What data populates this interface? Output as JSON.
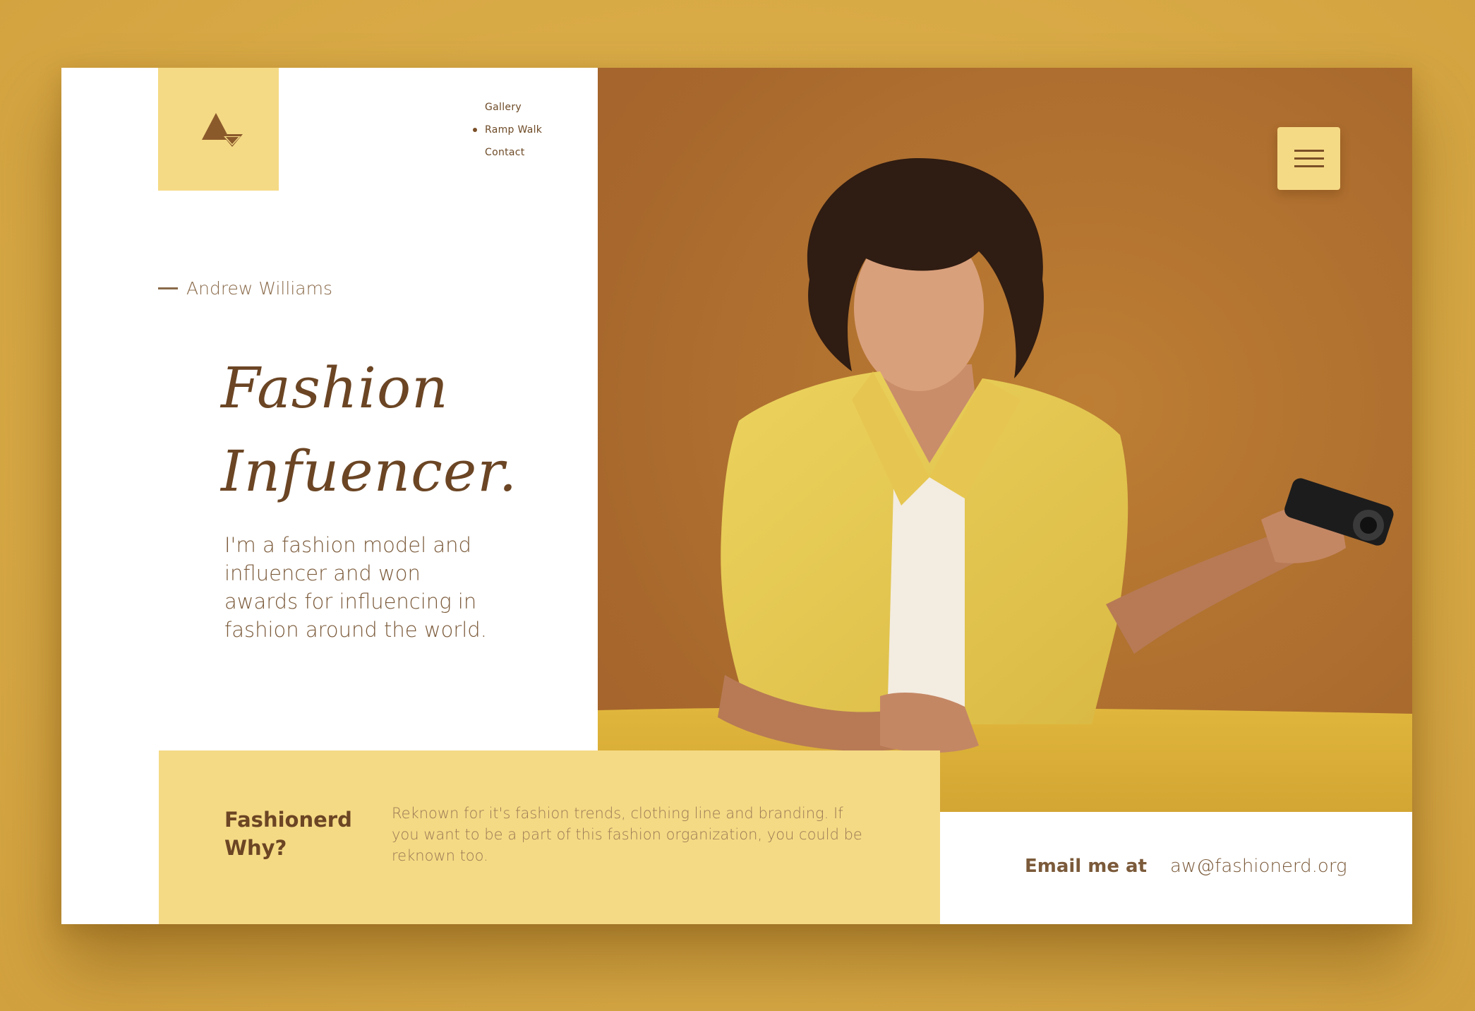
{
  "nav": {
    "items": [
      {
        "label": "Gallery",
        "active": false
      },
      {
        "label": "Ramp Walk",
        "active": true
      },
      {
        "label": "Contact",
        "active": false
      }
    ]
  },
  "hero": {
    "author": "Andrew Williams",
    "headline_line1": "Fashion",
    "headline_line2": "Infuencer.",
    "description": "I'm a fashion model and influencer and won awards for influencing in fashion around the world."
  },
  "info": {
    "title_line1": "Fashionerd",
    "title_line2": "Why?",
    "text": "Reknown for it's fashion trends, clothing line and branding. If you want to be a part of this fashion organization, you could be reknown too."
  },
  "contact": {
    "label": "Email me at",
    "email": "aw@fashionerd.org"
  },
  "icons": {
    "logo": "triangle-logo-icon",
    "menu": "hamburger-menu-icon"
  },
  "colors": {
    "background": "#d9ab47",
    "accent_yellow": "#f5da85",
    "brown_text": "#6b4524",
    "photo_backdrop": "#b47431"
  }
}
